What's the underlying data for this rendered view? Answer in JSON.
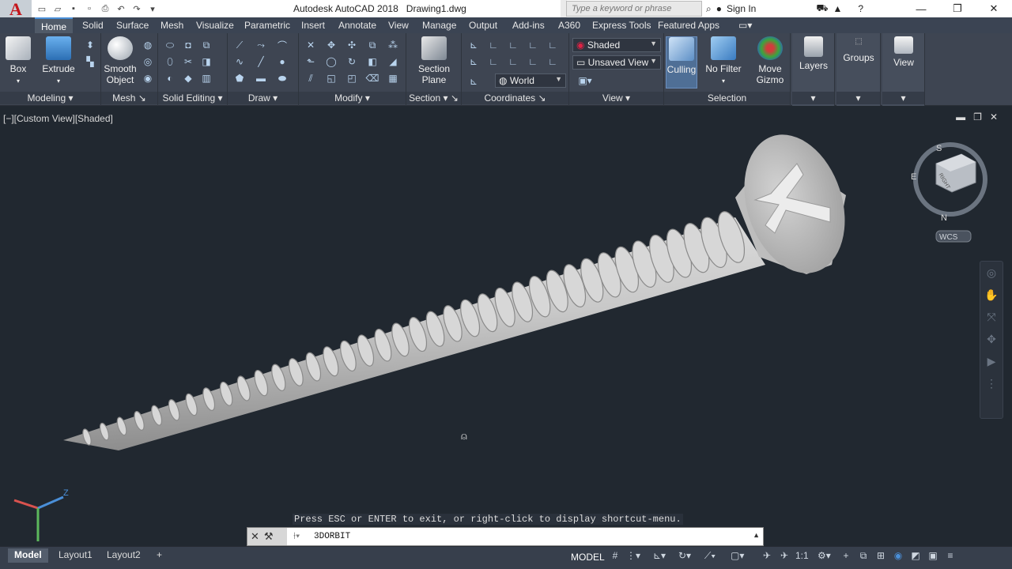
{
  "titlebar": {
    "app_title": "Autodesk AutoCAD 2018",
    "file_name": "Drawing1.dwg",
    "search_placeholder": "Type a keyword or phrase",
    "signin_label": "Sign In",
    "app_button_letter": "A"
  },
  "tabs": [
    "Home",
    "Solid",
    "Surface",
    "Mesh",
    "Visualize",
    "Parametric",
    "Insert",
    "Annotate",
    "View",
    "Manage",
    "Output",
    "Add-ins",
    "A360",
    "Express Tools",
    "Featured Apps"
  ],
  "ribbon": {
    "modeling": {
      "title": "Modeling",
      "box": "Box",
      "extrude": "Extrude"
    },
    "mesh": {
      "title": "Mesh",
      "smooth": "Smooth",
      "object": "Object"
    },
    "solid_editing": {
      "title": "Solid Editing"
    },
    "draw": {
      "title": "Draw"
    },
    "modify": {
      "title": "Modify"
    },
    "section": {
      "title": "Section",
      "plane1": "Section",
      "plane2": "Plane"
    },
    "coordinates": {
      "title": "Coordinates",
      "world": "World"
    },
    "view": {
      "title": "View",
      "visual_style": "Shaded",
      "named_view": "Unsaved View"
    },
    "selection": {
      "title": "Selection",
      "culling": "Culling",
      "no_filter": "No Filter",
      "move1": "Move",
      "move2": "Gizmo"
    },
    "layers": "Layers",
    "groups": "Groups",
    "view_btn": "View"
  },
  "viewport": {
    "label": "[−][Custom View][Shaded]",
    "viewcube": {
      "top_letter": "S",
      "left_letter": "E",
      "bottom_letter": "N",
      "face": "RIGHT",
      "wcs": "WCS"
    }
  },
  "command": {
    "history": "Press ESC or ENTER to exit, or right-click to display shortcut-menu.",
    "current": "3DORBIT"
  },
  "status": {
    "layouts": [
      "Model",
      "Layout1",
      "Layout2"
    ],
    "model_label": "MODEL",
    "scale": "1:1"
  },
  "colors": {
    "accent": "#4a8fd8",
    "brand_red": "#c4161c",
    "viewport_bg": "#212830"
  }
}
